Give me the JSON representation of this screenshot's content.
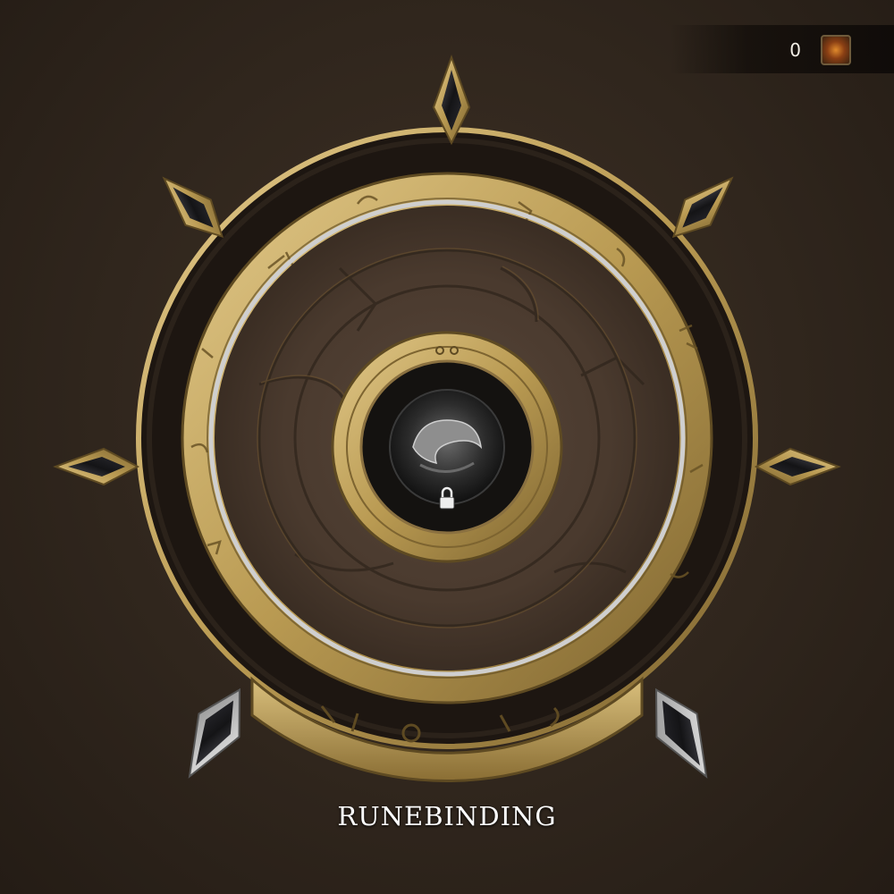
{
  "currency": {
    "count": "0",
    "icon": "rune-shard-icon"
  },
  "title": "RUNEBINDING",
  "core_slot": {
    "state": "locked",
    "lock_icon": "padlock-icon"
  },
  "socket_count": 7,
  "colors": {
    "gold": "#c7a960",
    "gold_dark": "#6f5a2c",
    "leather": "#4a3a2d",
    "background": "#30261d",
    "gem": "#1c1c1f",
    "silver": "#c8c8c8"
  }
}
